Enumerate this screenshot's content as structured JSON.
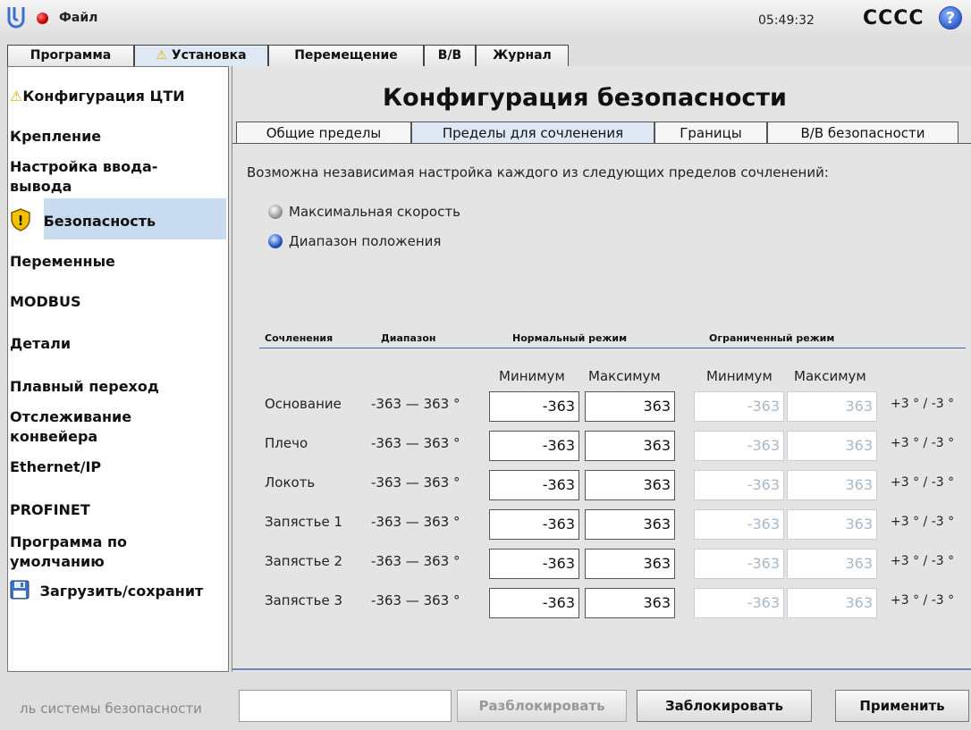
{
  "header": {
    "file_menu": "Файл",
    "time": "05:49:32",
    "robot_name": "CCCC"
  },
  "main_tabs": [
    {
      "label": "Программа"
    },
    {
      "label": "Установка",
      "warning": true
    },
    {
      "label": "Перемещение"
    },
    {
      "label": "В/В"
    },
    {
      "label": "Журнал"
    }
  ],
  "sidebar": {
    "items": [
      {
        "label": "Конфигурация ЦТИ"
      },
      {
        "label": "Крепление"
      },
      {
        "label": "Настройка ввода-"
      },
      {
        "label": "вывода"
      },
      {
        "label": "Безопасность",
        "selected": true
      },
      {
        "label": "Переменные"
      },
      {
        "label": "MODBUS"
      },
      {
        "label": "Детали"
      },
      {
        "label": "Плавный переход"
      },
      {
        "label": "Отслеживание"
      },
      {
        "label": "конвейера"
      },
      {
        "label": "Ethernet/IP"
      },
      {
        "label": "PROFINET"
      },
      {
        "label": "Программа по"
      },
      {
        "label": "умолчанию"
      },
      {
        "label": "Загрузить/сохранит"
      }
    ]
  },
  "content": {
    "title": "Конфигурация безопасности",
    "sub_tabs": [
      "Общие пределы",
      "Пределы для сочленения",
      "Границы",
      "В/В безопасности"
    ],
    "intro": "Возможна независимая настройка каждого из следующих пределов сочленений:",
    "options": [
      {
        "label": "Максимальная скорость",
        "selected": false
      },
      {
        "label": "Диапазон положения",
        "selected": true
      }
    ],
    "columns": {
      "joints": "Сочленения",
      "range": "Диапазон",
      "normal": "Нормальный режим",
      "reduced": "Ограниченный режим",
      "min": "Минимум",
      "max": "Максимум"
    },
    "rows": [
      {
        "name": "Основание",
        "range": "-363 — 363 °",
        "n_min": "-363",
        "n_max": "363",
        "r_min": "-363",
        "r_max": "363",
        "tol": "+3 ° / -3 °"
      },
      {
        "name": "Плечо",
        "range": "-363 — 363 °",
        "n_min": "-363",
        "n_max": "363",
        "r_min": "-363",
        "r_max": "363",
        "tol": "+3 ° / -3 °"
      },
      {
        "name": "Локоть",
        "range": "-363 — 363 °",
        "n_min": "-363",
        "n_max": "363",
        "r_min": "-363",
        "r_max": "363",
        "tol": "+3 ° / -3 °"
      },
      {
        "name": "Запястье 1",
        "range": "-363 — 363 °",
        "n_min": "-363",
        "n_max": "363",
        "r_min": "-363",
        "r_max": "363",
        "tol": "+3 ° / -3 °"
      },
      {
        "name": "Запястье 2",
        "range": "-363 — 363 °",
        "n_min": "-363",
        "n_max": "363",
        "r_min": "-363",
        "r_max": "363",
        "tol": "+3 ° / -3 °"
      },
      {
        "name": "Запястье 3",
        "range": "-363 — 363 °",
        "n_min": "-363",
        "n_max": "363",
        "r_min": "-363",
        "r_max": "363",
        "tol": "+3 ° / -3 °"
      }
    ]
  },
  "footer": {
    "password_label": "ль системы безопасности",
    "unlock": "Разблокировать",
    "lock": "Заблокировать",
    "apply": "Применить"
  }
}
